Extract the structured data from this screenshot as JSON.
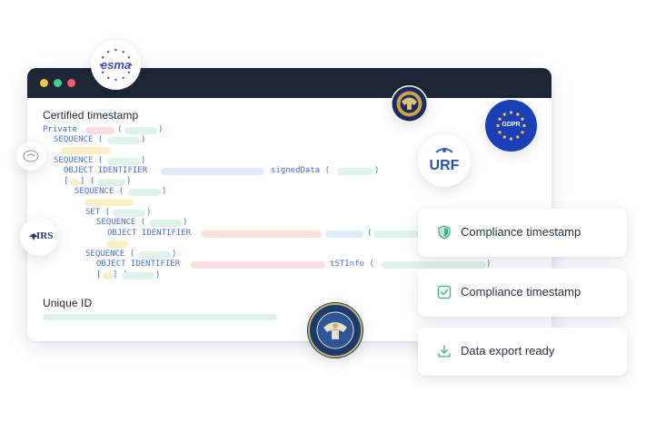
{
  "window": {
    "certified_title": "Certified timestamp",
    "unique_id_title": "Unique ID",
    "code_lines": [
      "Private",
      "SEQUENCE (",
      "SEQUENCE (",
      "OBJECT IDENTIFIER",
      "signedData (",
      "[",
      "(",
      "SEQUENCE (",
      "SET (",
      "SEQUENCE (",
      "OBJECT IDENTIFIER",
      "(",
      "SEQUENCE (",
      "OBJECT IDENTIFIER",
      "tSTInfo (",
      ")",
      "[",
      "(",
      ")",
      ")",
      ")",
      ")",
      ")"
    ]
  },
  "badges": {
    "esma": "esma",
    "urf": "URF",
    "irs": "IRS",
    "gdpr": "GDPR"
  },
  "cards": [
    {
      "label": "Compliance timestamp",
      "icon": "shield-icon"
    },
    {
      "label": "Compliance timestamp",
      "icon": "check-square-icon"
    },
    {
      "label": "Data export ready",
      "icon": "download-icon"
    }
  ],
  "colors": {
    "titlebar": "#1e2535",
    "accent_green": "#3bb27f",
    "code_blue": "#4a6fd0",
    "gdpr_blue": "#1a3fb8",
    "gdpr_star": "#f4cf2a"
  }
}
